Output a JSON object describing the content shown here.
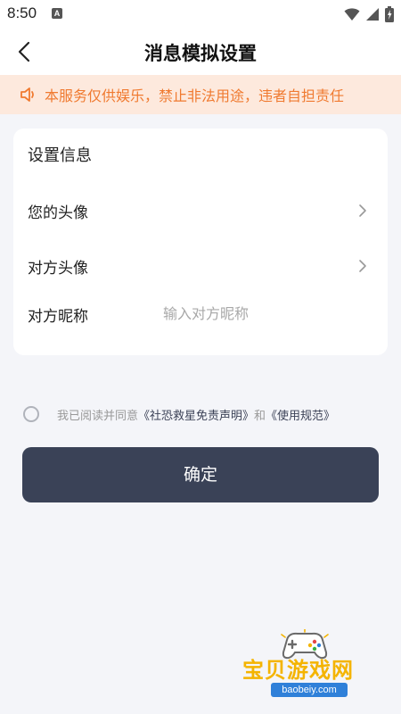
{
  "status_bar": {
    "time": "8:50",
    "notification_badge": "A"
  },
  "header": {
    "title": "消息模拟设置"
  },
  "notice": {
    "text": "本服务仅供娱乐，禁止非法用途，违者自担责任",
    "color": "#f07a30",
    "background": "#fde9dd"
  },
  "settings": {
    "section_title": "设置信息",
    "my_avatar_label": "您的头像",
    "other_avatar_label": "对方头像",
    "nickname_label": "对方昵称",
    "nickname_value": "",
    "nickname_placeholder": "输入对方昵称"
  },
  "agreement": {
    "prefix": "我已阅读并同意",
    "disclaimer_link": "《社恐救星免责声明》",
    "conjunction": "和",
    "terms_link": "《使用规范》",
    "checked": false
  },
  "confirm": {
    "label": "确定",
    "background": "#3a4257"
  },
  "watermark": {
    "title": "宝贝游戏网",
    "domain": "baobeiy.com"
  },
  "icons": {
    "back": "chevron-left-icon",
    "notice": "speaker-icon",
    "row_arrow": "chevron-right-icon"
  }
}
